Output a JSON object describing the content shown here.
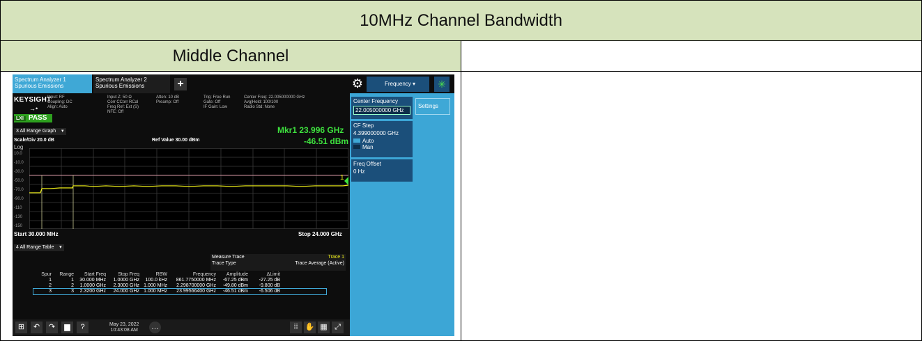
{
  "table": {
    "title": "10MHz Channel Bandwidth",
    "col_left_header": "Middle Channel"
  },
  "analyzer": {
    "tab1_line1": "Spectrum Analyzer 1",
    "tab1_line2": "Spurious Emissions",
    "tab2_line1": "Spectrum Analyzer 2",
    "tab2_line2": "Spurious Emissions",
    "add_tab": "+",
    "menu_label": "Frequency",
    "brand": "KEYSIGHT",
    "info_col1": "Input: RF\nCoupling: DC\nAlign: Auto",
    "info_col2": "Input Z: 50 Ω\nCorr CCorr RCal\nFreq Ref: Ext (S)\nNFE: Off",
    "info_col3": "Atten: 10 dB\nPreamp: Off",
    "info_col4": "Trig: Free Run\nGate: Off\nIF Gain: Low",
    "info_col5": "Center Freq: 22.005000000 GHz\nAvg|Hold: 100/100\nRadio Std: None",
    "lxi": "LXI",
    "status": "PASS",
    "graph_window": "3 All Range Graph",
    "marker_label": "Mkr1  23.996 GHz",
    "marker_value": "-46.51 dBm",
    "scale": "Scale/Div 20.0 dB",
    "ref_value": "Ref Value 30.00 dBm",
    "log": "Log",
    "y_ticks": [
      "10.0",
      "-10.0",
      "-30.0",
      "-50.0",
      "-70.0",
      "-90.0",
      "-110",
      "-130",
      "-150"
    ],
    "marker_number": "1",
    "start": "Start 30.000 MHz",
    "stop": "Stop 24.000 GHz",
    "table_window": "4 All Range Table",
    "measure_trace_label": "Measure Trace",
    "measure_trace_value": "Trace 1",
    "trace_type_label": "Trace Type",
    "trace_type_value": "Trace Average (Active)",
    "columns": [
      "Spur",
      "Range",
      "Start Freq",
      "Stop Freq",
      "RBW",
      "Frequency",
      "Amplitude",
      "ΔLimit"
    ],
    "rows": [
      [
        "1",
        "1",
        "30.000 MHz",
        "1.0000 GHz",
        "100.0 kHz",
        "861.7750000 MHz",
        "-67.25 dBm",
        "-27.25 dB"
      ],
      [
        "2",
        "2",
        "1.0000 GHz",
        "2.3000 GHz",
        "1.000 MHz",
        "2.298700000 GHz",
        "-49.80 dBm",
        "-9.800 dB"
      ],
      [
        "3",
        "3",
        "2.3200 GHz",
        "24.000 GHz",
        "1.000 MHz",
        "23.99566400 GHz",
        "-46.51 dBm",
        "-6.506 dB"
      ]
    ],
    "date": "May 23, 2022",
    "time": "10:43:08 AM",
    "panel": {
      "center_freq_label": "Center Frequency",
      "center_freq_value": "22.005000000 GHz",
      "cf_step_label": "CF Step",
      "cf_step_value": "4.399000000 GHz",
      "auto": "Auto",
      "man": "Man",
      "freq_offset_label": "Freq Offset",
      "freq_offset_value": "0 Hz",
      "settings": "Settings"
    },
    "trace_colors": {
      "trace": "#f2f21a",
      "limit": "#d99aa6",
      "grid": "#3a3a3a",
      "marker": "#3ee13e"
    }
  }
}
